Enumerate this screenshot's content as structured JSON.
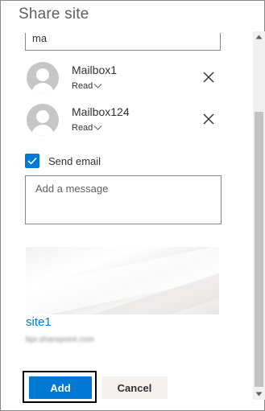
{
  "dialog": {
    "title": "Share site"
  },
  "search": {
    "value": "ma"
  },
  "people": [
    {
      "name": "Mailbox1",
      "permission": "Read"
    },
    {
      "name": "Mailbox124",
      "permission": "Read"
    }
  ],
  "send_email": {
    "label": "Send email",
    "checked": true
  },
  "message": {
    "placeholder": "Add a message"
  },
  "site": {
    "name": "site1",
    "url": "bpr.sharepoint.com"
  },
  "buttons": {
    "add_label": "Add",
    "cancel_label": "Cancel"
  },
  "colors": {
    "accent": "#0078d4",
    "avatar": "#c8c6c4",
    "focus": "#000000"
  },
  "icons": {
    "remove": "close-icon",
    "permission": "chevron-down-icon",
    "checkbox": "checkmark-icon",
    "avatar": "person-icon"
  }
}
